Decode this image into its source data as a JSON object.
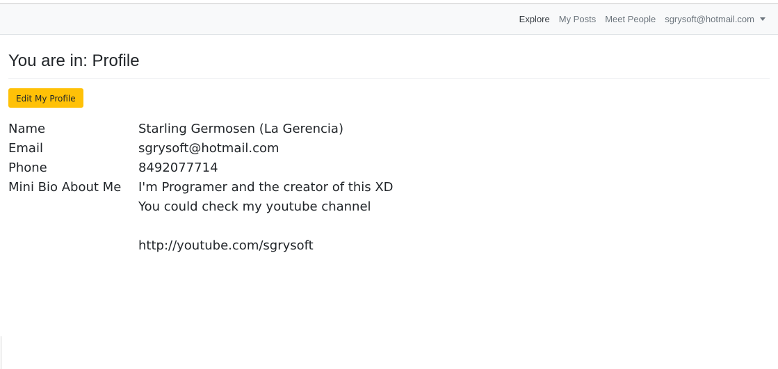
{
  "navbar": {
    "items": [
      {
        "label": "Explore",
        "active": true
      },
      {
        "label": "My Posts",
        "active": false
      },
      {
        "label": "Meet People",
        "active": false
      }
    ],
    "user_menu": {
      "label": "sgrysoft@hotmail.com",
      "icon": "caret-down-icon"
    }
  },
  "page": {
    "title": "You are in: Profile",
    "edit_button_label": "Edit My Profile"
  },
  "profile": {
    "name_label": "Name",
    "name_value": "Starling Germosen (La Gerencia)",
    "email_label": "Email",
    "email_value": "sgrysoft@hotmail.com",
    "phone_label": "Phone",
    "phone_value": "8492077714",
    "bio_label": "Mini Bio About Me",
    "bio_lines": [
      "I'm Programer and the creator of this XD",
      "You could check my youtube channel",
      "",
      "http://youtube.com/sgrysoft"
    ]
  },
  "colors": {
    "navbar_bg": "#f8f9fa",
    "button_warning": "#ffc107",
    "text": "#212529",
    "muted": "#6c757d"
  }
}
